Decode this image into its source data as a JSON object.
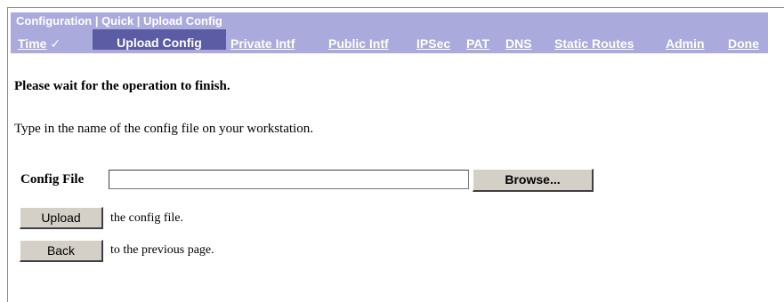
{
  "breadcrumb": "Configuration | Quick | Upload Config",
  "nav": {
    "time": "Time",
    "upload_config": "Upload Config",
    "private_intf": "Private Intf",
    "public_intf": "Public Intf",
    "ipsec": "IPSec",
    "pat": "PAT",
    "dns": "DNS",
    "static_routes": "Static Routes",
    "admin": "Admin",
    "done": "Done",
    "check_glyph": "✓"
  },
  "messages": {
    "wait": "Please wait for the operation to finish.",
    "instruction": "Type in the name of the config file on your workstation."
  },
  "form": {
    "config_file_label": "Config File",
    "config_file_value": "",
    "browse_label": "Browse...",
    "upload_label": "Upload",
    "upload_suffix": "the config file.",
    "back_label": "Back",
    "back_suffix": "to the previous page."
  },
  "colors": {
    "banner": "#aaaadd",
    "active_tab": "#5c5ca4"
  }
}
